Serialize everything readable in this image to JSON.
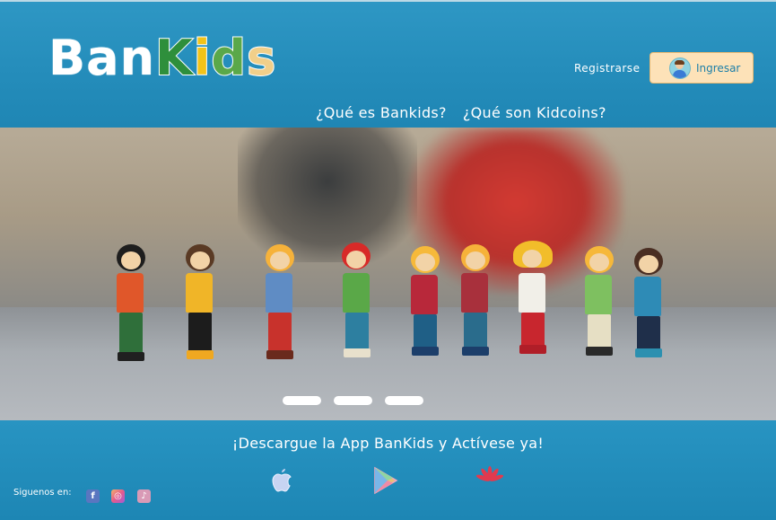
{
  "brand": {
    "logo_parts": [
      "Ban",
      "K",
      "i",
      "d",
      "s"
    ]
  },
  "header": {
    "register_label": "Registrarse",
    "login_label": "Ingresar",
    "nav": [
      {
        "label": "¿Qué es Bankids?"
      },
      {
        "label": "¿Qué son Kidcoins?"
      }
    ]
  },
  "hero": {
    "carousel_slides": 3,
    "active_slide": 1
  },
  "footer": {
    "cta": "¡Descargue la App BanKids y Actívese ya!",
    "follow_label": "Siguenos en:",
    "social": [
      "facebook-icon",
      "instagram-icon",
      "other-social-icon"
    ],
    "stores": [
      "apple-store-icon",
      "google-play-icon",
      "huawei-appgallery-icon"
    ]
  },
  "colors": {
    "primary_blue": "#2196c3",
    "login_bg": "#fde2b8",
    "logo_green": "#2e8f3c",
    "logo_yellow": "#f2c318"
  }
}
